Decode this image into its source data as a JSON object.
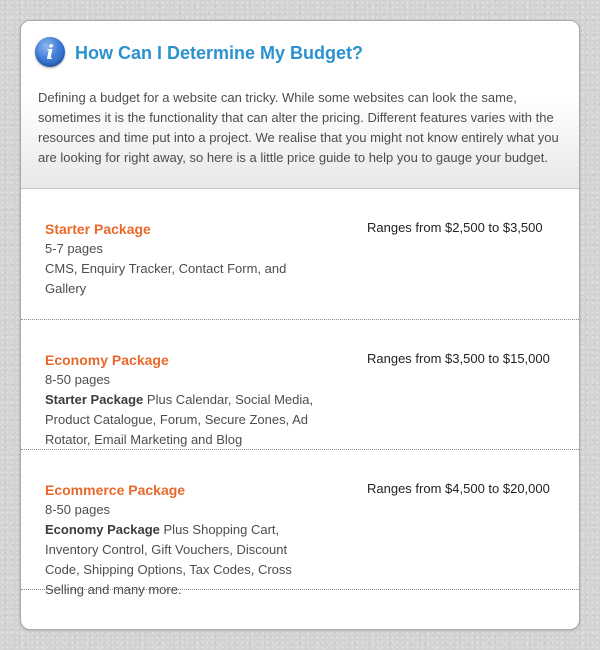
{
  "header": {
    "icon": "info-icon",
    "icon_glyph": "i",
    "title": "How Can I Determine My Budget?",
    "intro": "Defining a budget for a website can tricky. While some websites can look the same, sometimes it is the functionality that can alter the pricing. Different features varies with the resources and time put into a project. We realise that you might not know entirely what you are looking for right away, so here is a little price guide to help you to gauge your budget."
  },
  "packages": [
    {
      "name": "Starter Package",
      "pages": "5-7 pages",
      "features_prefix": "",
      "features": "CMS, Enquiry Tracker, Contact Form, and Gallery",
      "price": "Ranges from $2,500 to $3,500"
    },
    {
      "name": "Economy Package",
      "pages": "8-50 pages",
      "features_prefix": "Starter Package",
      "features": "Plus Calendar, Social Media, Product Catalogue, Forum, Secure Zones, Ad Rotator, Email Marketing and Blog",
      "price": "Ranges from $3,500 to $15,000"
    },
    {
      "name": "Ecommerce Package",
      "pages": "8-50 pages",
      "features_prefix": "Economy Package",
      "features": "Plus Shopping Cart, Inventory Control, Gift Vouchers, Discount Code, Shipping Options, Tax Codes, Cross Selling and many more.",
      "price": "Ranges from $4,500 to $20,000"
    }
  ],
  "colors": {
    "title": "#2b92cf",
    "package_name": "#e8692b",
    "body_text": "#4d4d4d",
    "icon": "#3f7fd8"
  }
}
